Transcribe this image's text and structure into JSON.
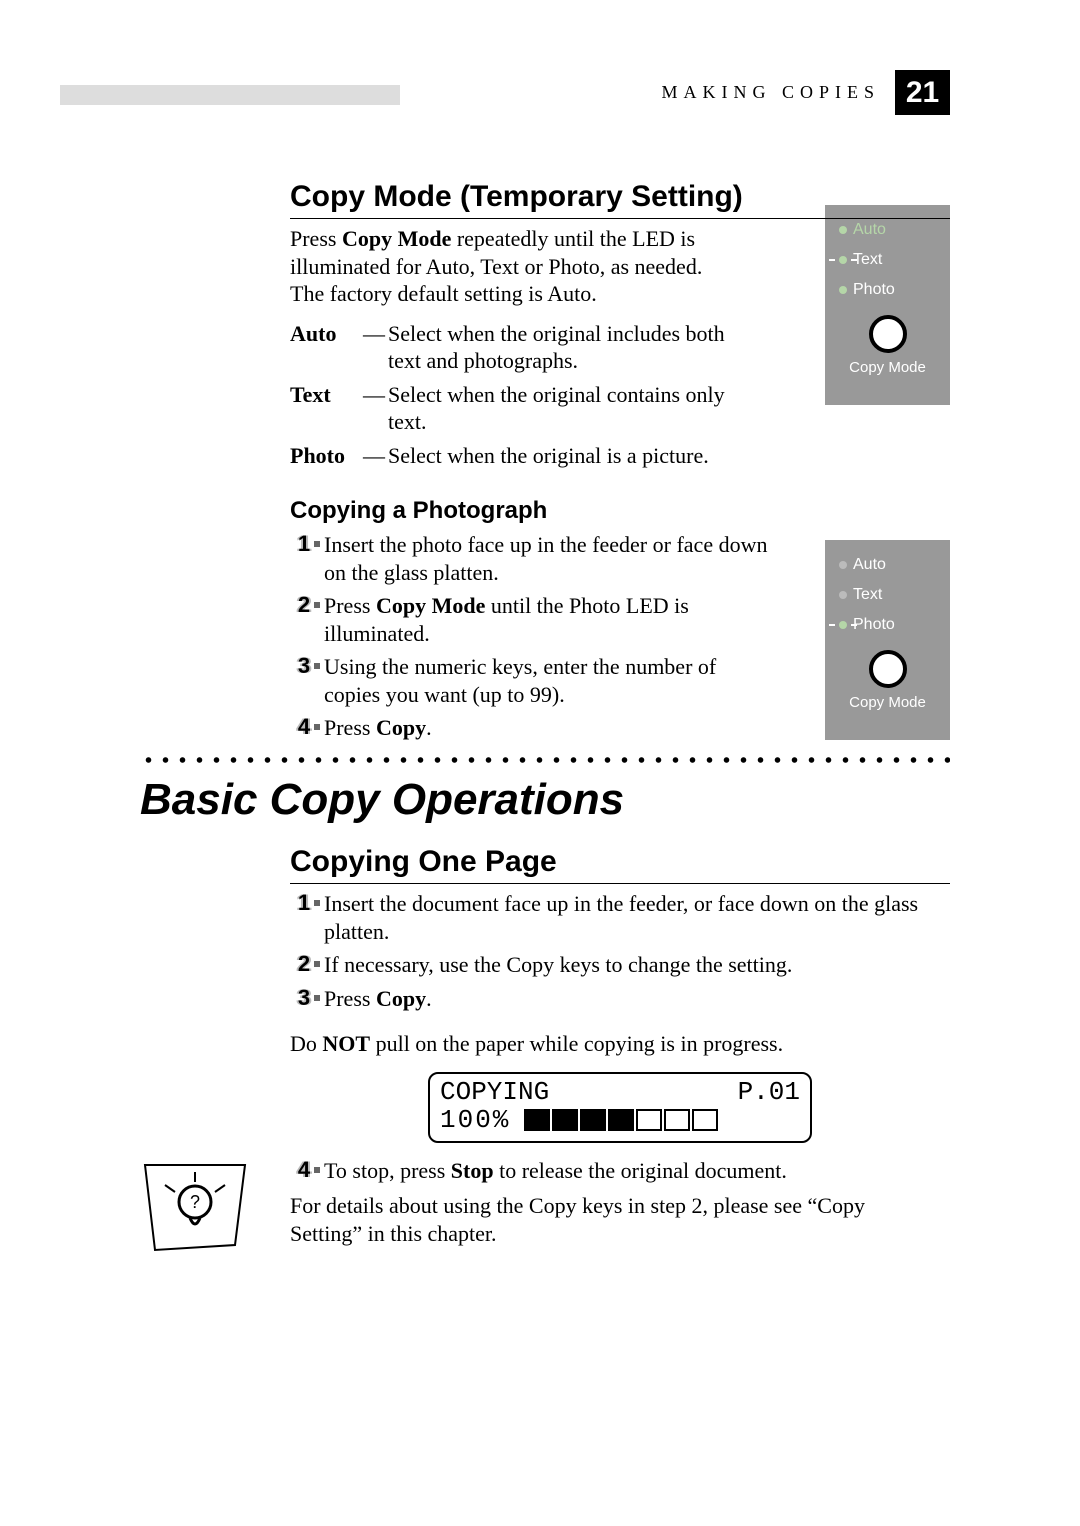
{
  "header": {
    "section_label": "MAKING COPIES",
    "page_number": "21"
  },
  "copy_mode_section": {
    "title": "Copy Mode (Temporary Setting)",
    "intro_prefix": "Press ",
    "intro_bold": "Copy Mode",
    "intro_suffix": " repeatedly until the LED is illuminated for  Auto, Text or Photo, as needed. The factory default setting is Auto.",
    "defs": [
      {
        "term": "Auto",
        "desc": "Select when the original includes both text and photographs."
      },
      {
        "term": "Text",
        "desc": "Select when the original contains only text."
      },
      {
        "term": "Photo",
        "desc": "Select when the original is a picture."
      }
    ],
    "panel": {
      "options": [
        "Auto",
        "Text",
        "Photo"
      ],
      "active": "Text",
      "caption": "Copy Mode"
    }
  },
  "copying_photo_section": {
    "title": "Copying a Photograph",
    "steps": [
      {
        "n": "1",
        "html": "Insert the photo face up in the feeder or face down on the glass platten."
      },
      {
        "n": "2",
        "prefix": "Press ",
        "bold": "Copy Mode",
        "suffix": " until the Photo LED is illuminated."
      },
      {
        "n": "3",
        "html": "Using the numeric keys, enter the number of copies you want (up to 99)."
      },
      {
        "n": "4",
        "prefix": "Press ",
        "bold": "Copy",
        "suffix": "."
      }
    ],
    "panel": {
      "options": [
        "Auto",
        "Text",
        "Photo"
      ],
      "active": "Photo",
      "caption": "Copy Mode"
    }
  },
  "basic_ops_heading": "Basic Copy Operations",
  "copying_one_page": {
    "title": "Copying One Page",
    "steps": [
      {
        "n": "1",
        "html": "Insert the document face up in the feeder, or face down on the glass platten."
      },
      {
        "n": "2",
        "html": "If necessary, use the Copy keys to change the setting."
      },
      {
        "n": "3",
        "prefix": "Press ",
        "bold": "Copy",
        "suffix": "."
      }
    ],
    "warning_prefix": "Do ",
    "warning_bold": "NOT",
    "warning_suffix": " pull on the paper while copying is in progress.",
    "lcd": {
      "line1_left": "COPYING",
      "line1_right": "P.01",
      "line2_left": "100%",
      "filled_blocks": 4,
      "empty_blocks": 3
    },
    "step4": {
      "n": "4",
      "prefix": "To stop, press ",
      "bold": "Stop",
      "suffix": " to release the original document."
    },
    "hint": "For details about using the Copy keys in step 2, please see “Copy Setting” in this chapter."
  }
}
